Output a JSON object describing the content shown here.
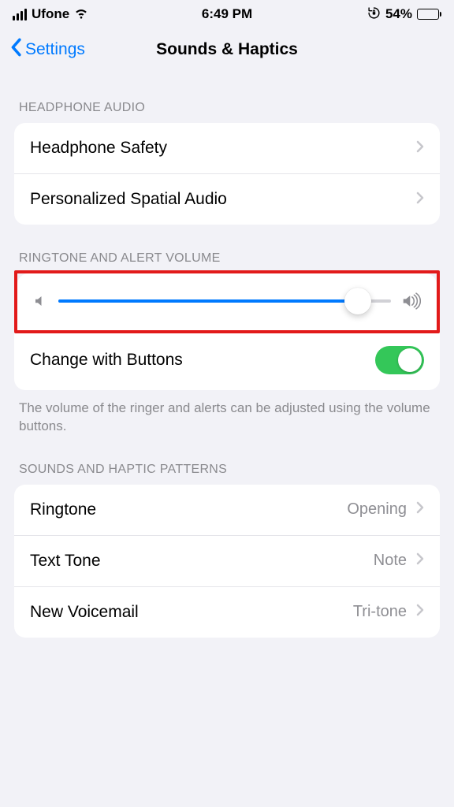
{
  "statusbar": {
    "carrier": "Ufone",
    "time": "6:49 PM",
    "battery_text": "54%",
    "battery_level_pct": 54
  },
  "nav": {
    "back_label": "Settings",
    "title": "Sounds & Haptics"
  },
  "sections": {
    "headphone": {
      "header": "HEADPHONE AUDIO",
      "items": [
        {
          "label": "Headphone Safety"
        },
        {
          "label": "Personalized Spatial Audio"
        }
      ]
    },
    "volume": {
      "header": "RINGTONE AND ALERT VOLUME",
      "slider_value_pct": 90,
      "change_with_buttons_label": "Change with Buttons",
      "change_with_buttons_on": true,
      "footer": "The volume of the ringer and alerts can be adjusted using the volume buttons."
    },
    "patterns": {
      "header": "SOUNDS AND HAPTIC PATTERNS",
      "items": [
        {
          "label": "Ringtone",
          "value": "Opening"
        },
        {
          "label": "Text Tone",
          "value": "Note"
        },
        {
          "label": "New Voicemail",
          "value": "Tri-tone"
        }
      ]
    }
  }
}
